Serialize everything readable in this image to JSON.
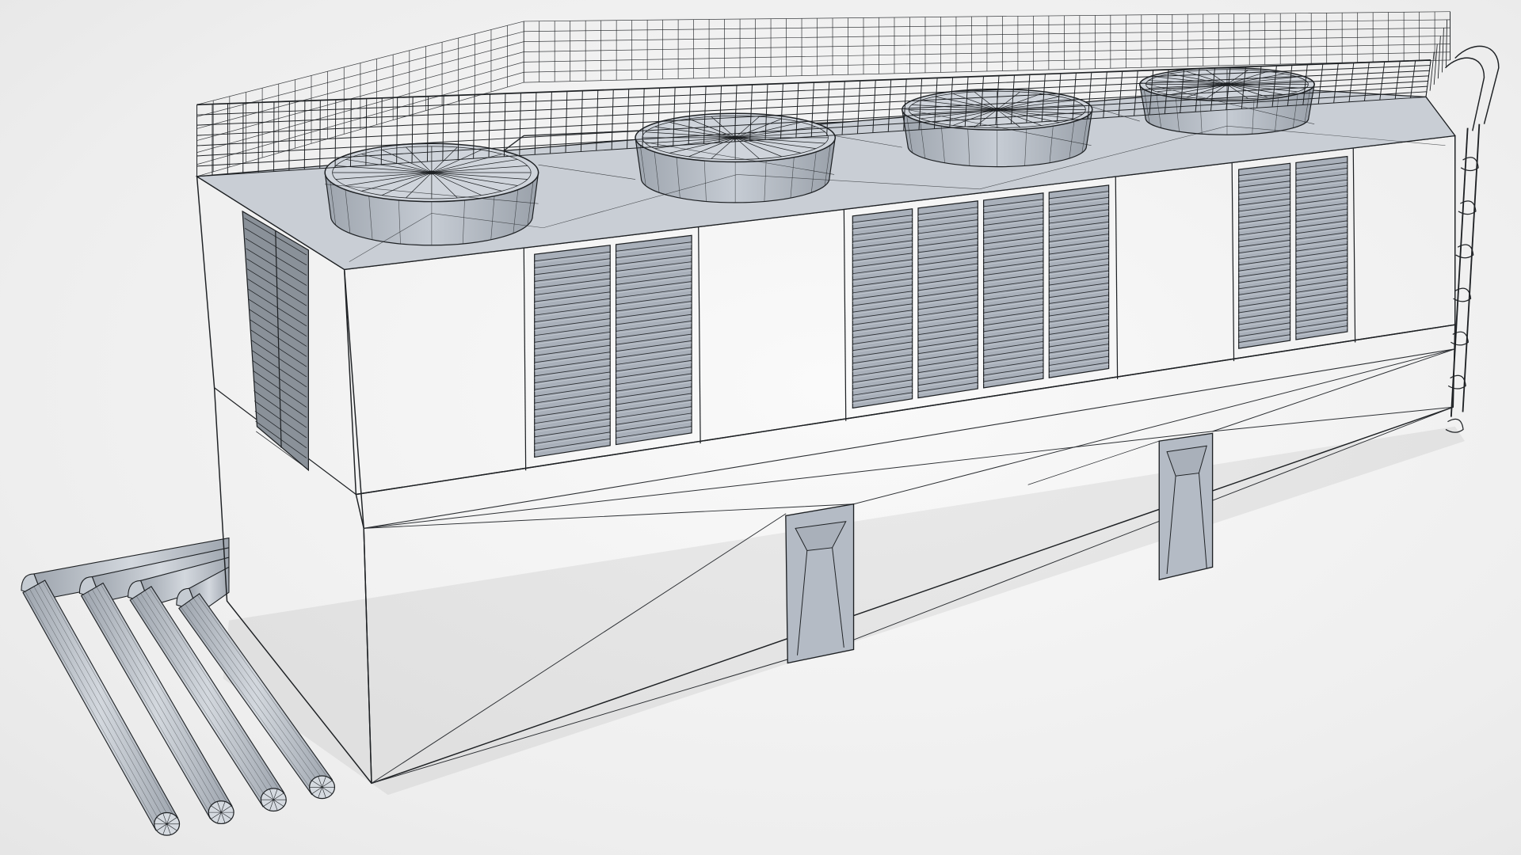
{
  "scene": {
    "subject": "cooling-tower-wireframe",
    "fan_count": 4,
    "pipe_count": 4,
    "has_guard_rail": true,
    "has_access_ladder": true
  },
  "colors": {
    "background": "#f2f2f2",
    "body_front": "#b9c0ca",
    "body_side": "#9aa1aa",
    "top_deck": "#c7ccd3",
    "louver_panel": "#a9b0ba",
    "wireframe": "#2c2f33",
    "pipe": "#b8bec6"
  },
  "icons": {
    "fan": "fan-icon",
    "ladder": "ladder-icon",
    "pipe": "pipe-icon",
    "louver": "louver-icon"
  }
}
